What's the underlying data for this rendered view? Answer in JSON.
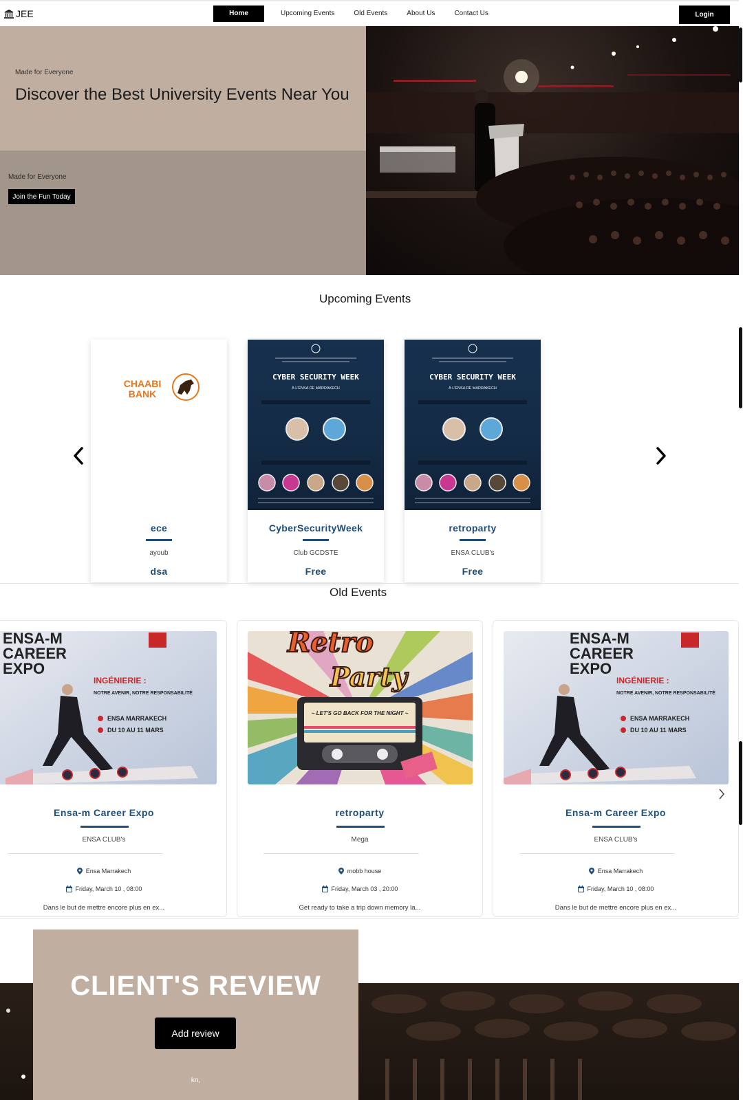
{
  "navbar": {
    "brand": "JEE",
    "links": [
      "Home",
      "Upcoming Events",
      "Old Events",
      "About Us",
      "Contact Us"
    ],
    "login": "Login"
  },
  "hero": {
    "tagline": "Made for Everyone",
    "title": "Discover the Best University Events Near You",
    "tagline2": "Made for Everyone",
    "cta": "Join the Fun Today"
  },
  "upcoming": {
    "title": "Upcoming Events",
    "cards": [
      {
        "title": "ece",
        "org": "ayoub",
        "price": "dsa",
        "logo_line1": "CHAABI",
        "logo_line2": "BANK"
      },
      {
        "title": "CyberSecurityWeek",
        "org": "Club GCDSTE",
        "price": "Free",
        "poster_heading": "CYBER SECURITY WEEK",
        "poster_sub": "À L'ENSA DE MARRAKECH"
      },
      {
        "title": "retroparty",
        "org": "ENSA CLUB's",
        "price": "Free",
        "poster_heading": "CYBER SECURITY WEEK",
        "poster_sub": "À L'ENSA DE MARRAKECH"
      }
    ]
  },
  "old": {
    "title": "Old Events",
    "cards": [
      {
        "title": "Ensa-m Career Expo",
        "org": "ENSA CLUB's",
        "location": "Ensa Marrakech",
        "date": "Friday, March 10 , 08:00",
        "desc": "Dans le but de mettre encore plus en ex...",
        "poster_l1": "ENSA-M",
        "poster_l2": "CAREER",
        "poster_l3": "EXPO",
        "poster_tag": "INGÉNIERIE :",
        "poster_tag2": "NOTRE AVENIR, NOTRE RESPONSABILITÉ",
        "poster_loc": "ENSA MARRAKECH",
        "poster_date": "DU 10 AU 11 MARS"
      },
      {
        "title": "retroparty",
        "org": "Mega",
        "location": "mobb house",
        "date": "Friday, March 03 , 20:00",
        "desc": "Get ready to take a trip down memory la...",
        "poster_l1": "Retro",
        "poster_l2": "Party",
        "poster_tag": "~ LET'S GO BACK FOR THE NIGHT ~"
      },
      {
        "title": "Ensa-m Career Expo",
        "org": "ENSA CLUB's",
        "location": "Ensa Marrakech",
        "date": "Friday, March 10 , 08:00",
        "desc": "Dans le but de mettre encore plus en ex...",
        "poster_l1": "ENSA-M",
        "poster_l2": "CAREER",
        "poster_l3": "EXPO",
        "poster_tag": "INGÉNIERIE :",
        "poster_tag2": "NOTRE AVENIR, NOTRE RESPONSABILITÉ",
        "poster_loc": "ENSA MARRAKECH",
        "poster_date": "DU 10 AU 11 MARS"
      }
    ]
  },
  "review": {
    "title": "CLIENT'S REVIEW",
    "button": "Add review",
    "text": "kn,"
  },
  "colors": {
    "accent": "#1f4e79",
    "hero_top": "#c0aea0",
    "hero_bottom": "#a2958a",
    "black": "#000000",
    "chaabi_orange": "#e8761b"
  },
  "icons": [
    "bank-icon",
    "chevron-left-icon",
    "chevron-right-icon",
    "location-pin-icon",
    "calendar-icon"
  ]
}
